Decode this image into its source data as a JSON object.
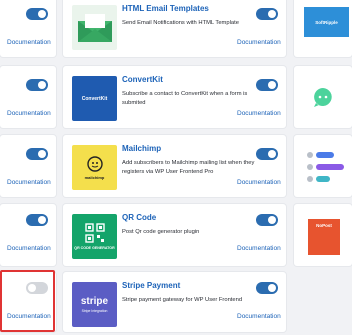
{
  "left_column": {
    "doc_label": "Documentation"
  },
  "plugins": [
    {
      "title": "HTML Email Templates",
      "description": "Send Email Notifications with HTML Template",
      "doc_label": "Documentation",
      "enabled": true
    },
    {
      "title": "ConvertKit",
      "description": "Subscribe a contact to ConvertKit when a form is submited",
      "doc_label": "Documentation",
      "enabled": true,
      "thumb_text": "ConvertKit"
    },
    {
      "title": "Mailchimp",
      "description": "Add subscribers to Mailchimp mailing list when they registers via WP User Frontend Pro",
      "doc_label": "Documentation",
      "enabled": true,
      "thumb_text": "mailchimp"
    },
    {
      "title": "QR Code",
      "description": "Post Qr code generator plugin",
      "doc_label": "Documentation",
      "enabled": true,
      "thumb_text": "QR CODE GENERATOR"
    },
    {
      "title": "Stripe Payment",
      "description": "Stripe payment gateway for WP User Frontend",
      "doc_label": "Documentation",
      "enabled": true,
      "thumb_text": "stripe",
      "thumb_subtext": "Stripe Integration"
    }
  ],
  "right_column": {
    "thumb1_text": "SoftRipple",
    "thumb4_text": "NoPost"
  },
  "colors": {
    "link": "#1d63b8",
    "toggle_on": "#2b6cb0",
    "toggle_off": "#d3d6db",
    "highlight": "#e03434"
  }
}
